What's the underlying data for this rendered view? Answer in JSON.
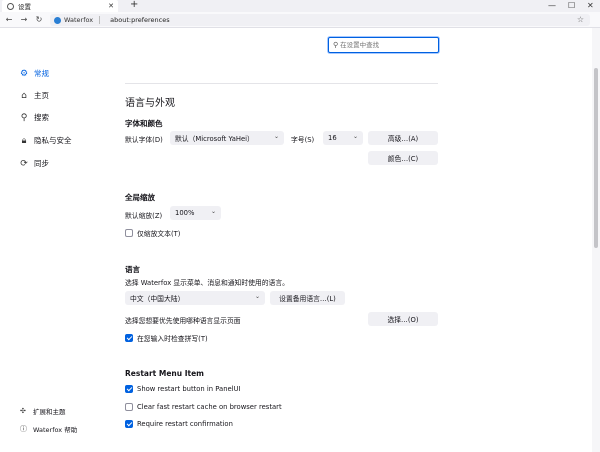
{
  "browser": {
    "tab_title": "设置",
    "new_tab": "+",
    "window_buttons": [
      "—",
      "☐",
      "✕"
    ],
    "brand": "Waterfox",
    "address": "about:preferences"
  },
  "search": {
    "placeholder": "在设置中查找"
  },
  "sidebar": {
    "items": [
      {
        "label": "常规",
        "icon": "gear-icon"
      },
      {
        "label": "主页",
        "icon": "home-icon"
      },
      {
        "label": "搜索",
        "icon": "search-icon"
      },
      {
        "label": "隐私与安全",
        "icon": "lock-icon"
      },
      {
        "label": "同步",
        "icon": "sync-icon"
      }
    ],
    "footer": [
      {
        "label": "扩展和主题",
        "icon": "puzzle-icon"
      },
      {
        "label": "Waterfox 帮助",
        "icon": "help-icon"
      }
    ]
  },
  "language_appearance": {
    "heading": "语言与外观",
    "fonts_heading": "字体和颜色",
    "default_font_label": "默认字体(D)",
    "default_font_value": "默认（Microsoft YaHei）",
    "size_label": "字号(S)",
    "size_value": "16",
    "advanced_button": "高级…(A)",
    "colors_button": "颜色…(C)"
  },
  "zoom": {
    "heading": "全局缩放",
    "default_zoom_label": "默认缩放(Z)",
    "default_zoom_value": "100%",
    "text_only_label": "仅缩放文本(T)",
    "text_only_checked": false
  },
  "language": {
    "heading": "语言",
    "description": "选择 Waterfox 显示菜单、消息和通知时使用的语言。",
    "language_value": "中文（中国大陆）",
    "alternates_button": "设置备用语言…(L)",
    "page_lang_label": "选择您想要优先使用哪种语言显示页面",
    "choose_button": "选择…(O)",
    "spellcheck_label": "在您输入时检查拼写(T)",
    "spellcheck_checked": true
  },
  "restart_menu": {
    "heading": "Restart Menu Item",
    "options": [
      {
        "label": "Show restart button in PanelUI",
        "checked": true
      },
      {
        "label": "Clear fast restart cache on browser restart",
        "checked": false
      },
      {
        "label": "Require restart confirmation",
        "checked": true
      }
    ]
  },
  "colors": {
    "accent": "#0061e0"
  }
}
